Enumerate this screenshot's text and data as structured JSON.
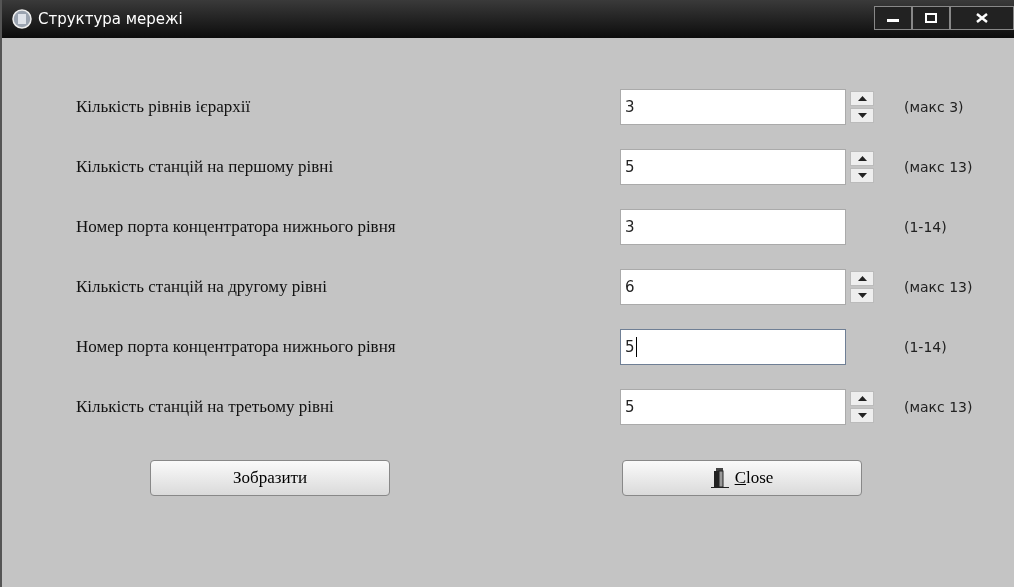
{
  "window": {
    "title": "Структура мережі"
  },
  "rows": [
    {
      "label": "Кількість рівнів ієрархії",
      "value": "3",
      "kind": "spin",
      "hint": "(макс 3)",
      "focused": false
    },
    {
      "label": "Кількість станцій на першому рівні",
      "value": "5",
      "kind": "spin",
      "hint": "(макс 13)",
      "focused": false
    },
    {
      "label": "Номер порта концентратора нижнього рівня",
      "value": "3",
      "kind": "plain",
      "hint": "(1-14)",
      "focused": false
    },
    {
      "label": "Кількість станцій на другому рівні",
      "value": "6",
      "kind": "spin",
      "hint": "(макс 13)",
      "focused": false
    },
    {
      "label": "Номер порта концентратора нижнього рівня",
      "value": "5",
      "kind": "plain",
      "hint": "(1-14)",
      "focused": true
    },
    {
      "label": "Кількість станцій на третьому рівні",
      "value": "5",
      "kind": "spin",
      "hint": "(макс 13)",
      "focused": false
    }
  ],
  "buttons": [
    {
      "label": "Зобразити",
      "kind": "plain"
    },
    {
      "label": "Close",
      "kind": "close"
    }
  ]
}
